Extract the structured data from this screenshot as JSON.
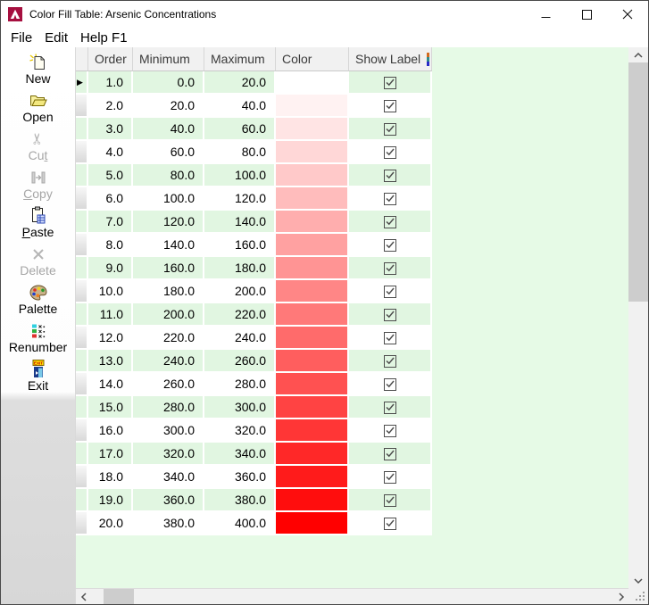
{
  "window": {
    "title": "Color Fill Table: Arsenic Concentrations"
  },
  "menu": {
    "items": [
      "File",
      "Edit",
      "Help F1"
    ]
  },
  "toolbar": {
    "items": [
      {
        "label": "New",
        "icon": "new-document-icon",
        "enabled": true,
        "underline": -1
      },
      {
        "label": "Open",
        "icon": "open-folder-icon",
        "enabled": true,
        "underline": -1
      },
      {
        "label": "Cut",
        "icon": "scissors-icon",
        "enabled": false,
        "underline": 2
      },
      {
        "label": "Copy",
        "icon": "copy-icon",
        "enabled": false,
        "underline": 0
      },
      {
        "label": "Paste",
        "icon": "paste-clipboard-icon",
        "enabled": true,
        "underline": 0
      },
      {
        "label": "Delete",
        "icon": "delete-x-icon",
        "enabled": false,
        "underline": -1
      },
      {
        "label": "Palette",
        "icon": "palette-icon",
        "enabled": true,
        "underline": -1
      },
      {
        "label": "Renumber",
        "icon": "renumber-icon",
        "enabled": true,
        "underline": -1
      },
      {
        "label": "Exit",
        "icon": "exit-door-icon",
        "enabled": true,
        "underline": -1
      }
    ]
  },
  "table": {
    "columns": [
      "Order",
      "Minimum",
      "Maximum",
      "Color",
      "Show Label"
    ],
    "current_row": 1,
    "rows": [
      {
        "order": "1.0",
        "minimum": "0.0",
        "maximum": "20.0",
        "color": "#ffffff",
        "show_label": true
      },
      {
        "order": "2.0",
        "minimum": "20.0",
        "maximum": "40.0",
        "color": "#fff2f2",
        "show_label": true
      },
      {
        "order": "3.0",
        "minimum": "40.0",
        "maximum": "60.0",
        "color": "#ffe4e4",
        "show_label": true
      },
      {
        "order": "4.0",
        "minimum": "60.0",
        "maximum": "80.0",
        "color": "#ffd7d7",
        "show_label": true
      },
      {
        "order": "5.0",
        "minimum": "80.0",
        "maximum": "100.0",
        "color": "#ffc9c9",
        "show_label": true
      },
      {
        "order": "6.0",
        "minimum": "100.0",
        "maximum": "120.0",
        "color": "#ffbcbc",
        "show_label": true
      },
      {
        "order": "7.0",
        "minimum": "120.0",
        "maximum": "140.0",
        "color": "#ffaeae",
        "show_label": true
      },
      {
        "order": "8.0",
        "minimum": "140.0",
        "maximum": "160.0",
        "color": "#ffa1a1",
        "show_label": true
      },
      {
        "order": "9.0",
        "minimum": "160.0",
        "maximum": "180.0",
        "color": "#ff9494",
        "show_label": true
      },
      {
        "order": "10.0",
        "minimum": "180.0",
        "maximum": "200.0",
        "color": "#ff8686",
        "show_label": true
      },
      {
        "order": "11.0",
        "minimum": "200.0",
        "maximum": "220.0",
        "color": "#ff7979",
        "show_label": true
      },
      {
        "order": "12.0",
        "minimum": "220.0",
        "maximum": "240.0",
        "color": "#ff6b6b",
        "show_label": true
      },
      {
        "order": "13.0",
        "minimum": "240.0",
        "maximum": "260.0",
        "color": "#ff5e5e",
        "show_label": true
      },
      {
        "order": "14.0",
        "minimum": "260.0",
        "maximum": "280.0",
        "color": "#ff5151",
        "show_label": true
      },
      {
        "order": "15.0",
        "minimum": "280.0",
        "maximum": "300.0",
        "color": "#ff4343",
        "show_label": true
      },
      {
        "order": "16.0",
        "minimum": "300.0",
        "maximum": "320.0",
        "color": "#ff3636",
        "show_label": true
      },
      {
        "order": "17.0",
        "minimum": "320.0",
        "maximum": "340.0",
        "color": "#ff2828",
        "show_label": true
      },
      {
        "order": "18.0",
        "minimum": "340.0",
        "maximum": "360.0",
        "color": "#ff1b1b",
        "show_label": true
      },
      {
        "order": "19.0",
        "minimum": "360.0",
        "maximum": "380.0",
        "color": "#ff0d0d",
        "show_label": true
      },
      {
        "order": "20.0",
        "minimum": "380.0",
        "maximum": "400.0",
        "color": "#ff0000",
        "show_label": true
      }
    ]
  },
  "colors": {
    "row_alt": "#e1f6e1",
    "page_bg": "#e6fae6",
    "header_bg": "#f1f1f1",
    "app_icon": "#a60f3f",
    "gradient_start": "#ffffff",
    "gradient_end": "#ff0000"
  }
}
